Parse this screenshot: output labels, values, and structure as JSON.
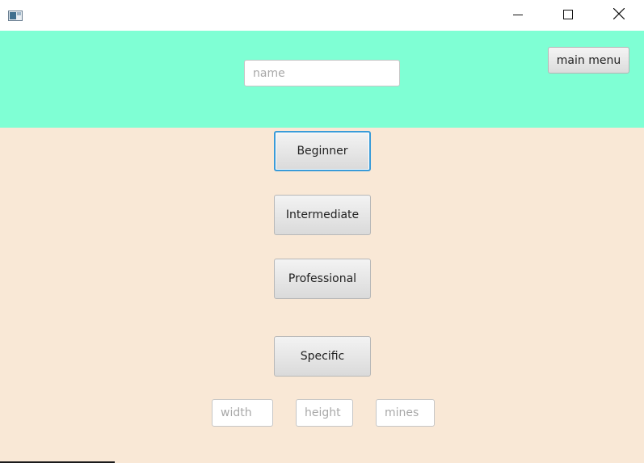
{
  "window": {
    "icons": {
      "app": "window-app-icon",
      "minimize": "minimize-icon",
      "maximize": "maximize-icon",
      "close": "close-icon"
    }
  },
  "header": {
    "name_placeholder": "name",
    "main_menu_label": "main menu",
    "background_color": "#7fffd4"
  },
  "levels": {
    "beginner_label": "Beginner",
    "intermediate_label": "Intermediate",
    "professional_label": "Professional",
    "specific_label": "Specific"
  },
  "custom": {
    "width_placeholder": "width",
    "height_placeholder": "height",
    "mines_placeholder": "mines"
  },
  "colors": {
    "content_background": "#f9e8d6",
    "focus_ring": "#3a9bd8"
  }
}
